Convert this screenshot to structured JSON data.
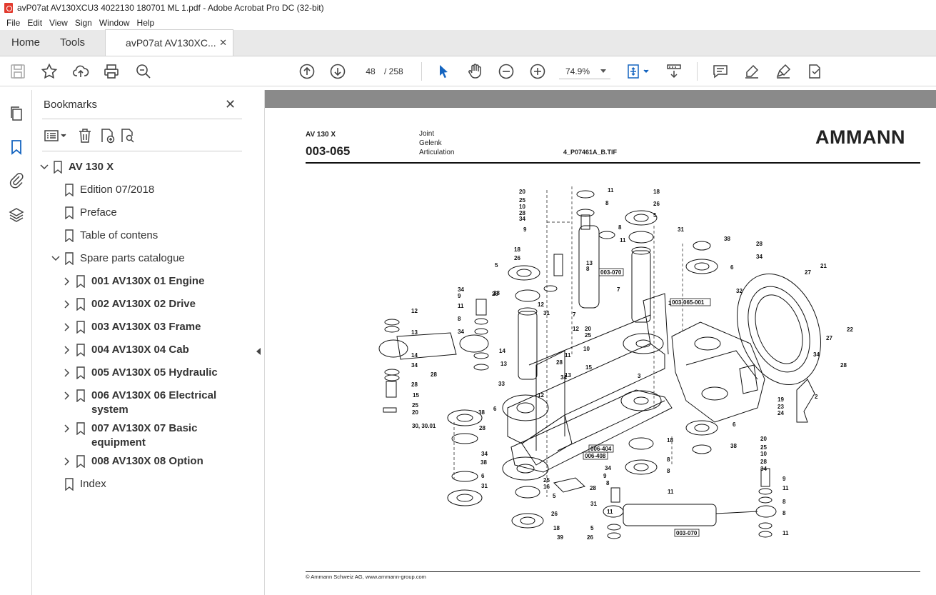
{
  "window": {
    "title": "avP07at AV130XCU3 4022130 180701 ML 1.pdf - Adobe Acrobat Pro DC (32-bit)"
  },
  "menu": [
    "File",
    "Edit",
    "View",
    "Sign",
    "Window",
    "Help"
  ],
  "tabs": {
    "home": "Home",
    "tools": "Tools",
    "document": "avP07at AV130XC...",
    "close": "✕"
  },
  "toolbar": {
    "page_current": "48",
    "page_total": "/ 258",
    "zoom": "74.9%"
  },
  "bookmarks": {
    "title": "Bookmarks",
    "close": "✕",
    "items": [
      {
        "label": "AV 130 X"
      },
      {
        "label": "Edition 07/2018"
      },
      {
        "label": "Preface"
      },
      {
        "label": "Table of contens"
      },
      {
        "label": "Spare parts catalogue"
      },
      {
        "label": "001 AV130X 01 Engine"
      },
      {
        "label": "002 AV130X 02 Drive"
      },
      {
        "label": "003 AV130X 03 Frame"
      },
      {
        "label": "004 AV130X 04 Cab"
      },
      {
        "label": "005 AV130X 05 Hydraulic"
      },
      {
        "label": "006 AV130X 06 Electrical",
        "label2": "system"
      },
      {
        "label": "007 AV130X 07 Basic",
        "label2": "equipment"
      },
      {
        "label": "008 AV130X 08 Option"
      },
      {
        "label": "Index"
      }
    ]
  },
  "page": {
    "model": "AV 130 X",
    "code": "003-065",
    "title_en": "Joint",
    "title_de": "Gelenk",
    "title_fr": "Articulation",
    "file": "4_P07461A_B.TIF",
    "logo": "AMMANN",
    "footer": "© Ammann Schweiz AG, www.ammann-group.com",
    "ref_labels": [
      "003-070",
      "003-065-001",
      "006-404",
      "006-408",
      "003-070"
    ],
    "part_labels": [
      "20",
      "25",
      "10",
      "28",
      "34",
      "9",
      "11",
      "8",
      "18",
      "26",
      "5",
      "31",
      "8",
      "11",
      "7",
      "38",
      "28",
      "34",
      "21",
      "27",
      "32",
      "6",
      "22",
      "27",
      "34",
      "28",
      "3",
      "2",
      "19",
      "23",
      "24",
      "1",
      "18",
      "26",
      "5",
      "28",
      "34",
      "9",
      "11",
      "8",
      "34",
      "28",
      "14",
      "13",
      "12",
      "31",
      "7",
      "12",
      "13",
      "8",
      "11",
      "28",
      "34",
      "20",
      "25",
      "10",
      "15",
      "13",
      "12",
      "12",
      "13",
      "14",
      "34",
      "28",
      "15",
      "25",
      "20",
      "30, 30.01",
      "28",
      "33",
      "6",
      "38",
      "28",
      "34",
      "38",
      "6",
      "31",
      "5",
      "26",
      "18",
      "39",
      "25",
      "16",
      "28",
      "34",
      "9",
      "8",
      "11",
      "31",
      "5",
      "26",
      "18",
      "8",
      "8",
      "11",
      "6",
      "38",
      "20",
      "25",
      "10",
      "28",
      "34",
      "9",
      "11",
      "8",
      "8",
      "11"
    ]
  }
}
